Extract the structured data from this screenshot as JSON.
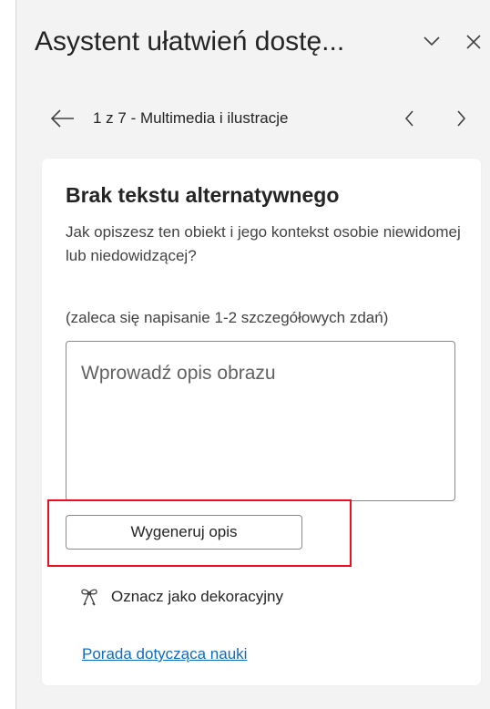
{
  "pane": {
    "title": "Asystent ułatwień dostę...",
    "minimize_icon": "chevron-down-icon",
    "close_icon": "close-icon"
  },
  "navigation": {
    "back_icon": "arrow-left-icon",
    "label": "1 z 7 - Multimedia i ilustracje",
    "prev_icon": "chevron-left-icon",
    "next_icon": "chevron-right-icon"
  },
  "card": {
    "title": "Brak tekstu alternatywnego",
    "description": "Jak opiszesz ten obiekt i jego kontekst osobie niewidomej lub niedowidzącej?",
    "hint": "(zaleca się napisanie 1-2 szczegółowych zdań)",
    "alt_text_value": "",
    "alt_text_placeholder": "Wprowadź opis obrazu",
    "generate_button_label": "Wygeneruj opis",
    "decorative_icon": "ribbon-icon",
    "decorative_label": "Oznacz jako dekoracyjny",
    "learn_link": "Porada dotycząca nauki"
  },
  "colors": {
    "pane_background": "#f3f3f3",
    "card_background": "#ffffff",
    "highlight_border": "#e81123",
    "link": "#0f6cbd"
  }
}
